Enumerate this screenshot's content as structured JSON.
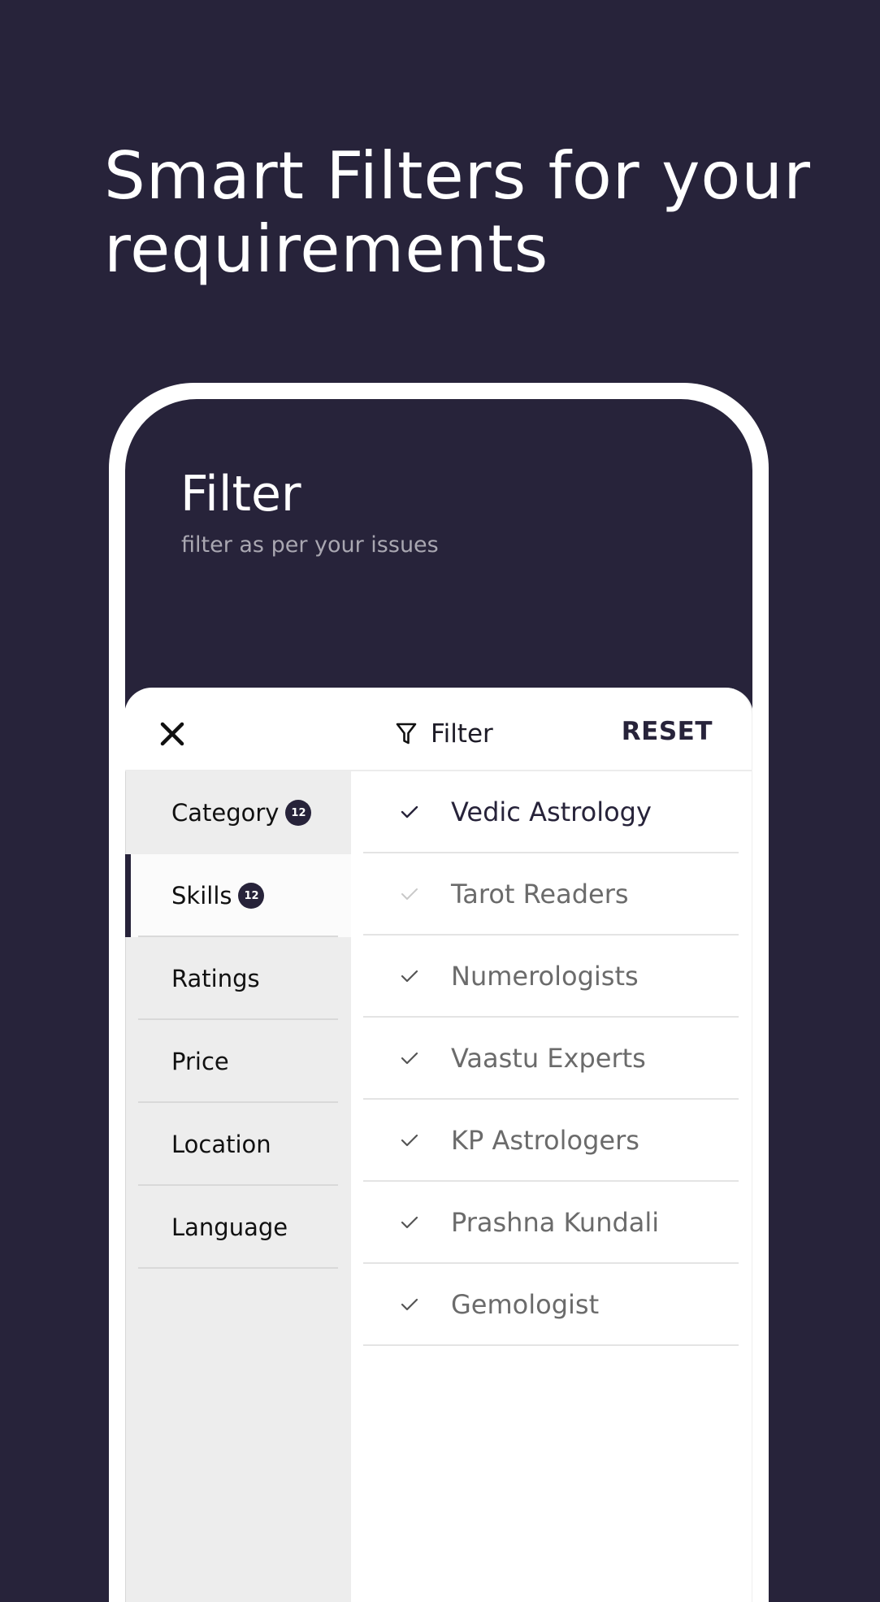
{
  "headline": "Smart Filters for your requirements",
  "colors": {
    "background": "#27233a",
    "accent": "#27233a",
    "selected_text": "#27233a",
    "unselected_text": "#6b6b6b"
  },
  "screen": {
    "title": "Filter",
    "subtitle": "filter as per your issues"
  },
  "sheet": {
    "close_icon": "close-icon",
    "filter_icon": "funnel-icon",
    "title": "Filter",
    "reset_label": "RESET"
  },
  "sidebar": {
    "active_index": 1,
    "items": [
      {
        "label": "Category",
        "badge": "12"
      },
      {
        "label": "Skills",
        "badge": "12"
      },
      {
        "label": "Ratings"
      },
      {
        "label": "Price"
      },
      {
        "label": "Location"
      },
      {
        "label": "Language"
      }
    ]
  },
  "options": {
    "items": [
      {
        "label": "Vedic Astrology",
        "selected": true
      },
      {
        "label": "Tarot Readers",
        "selected": false,
        "check_faded": true
      },
      {
        "label": "Numerologists",
        "selected": false
      },
      {
        "label": "Vaastu Experts",
        "selected": false
      },
      {
        "label": "KP Astrologers",
        "selected": false
      },
      {
        "label": "Prashna Kundali",
        "selected": false
      },
      {
        "label": "Gemologist",
        "selected": false
      }
    ]
  }
}
